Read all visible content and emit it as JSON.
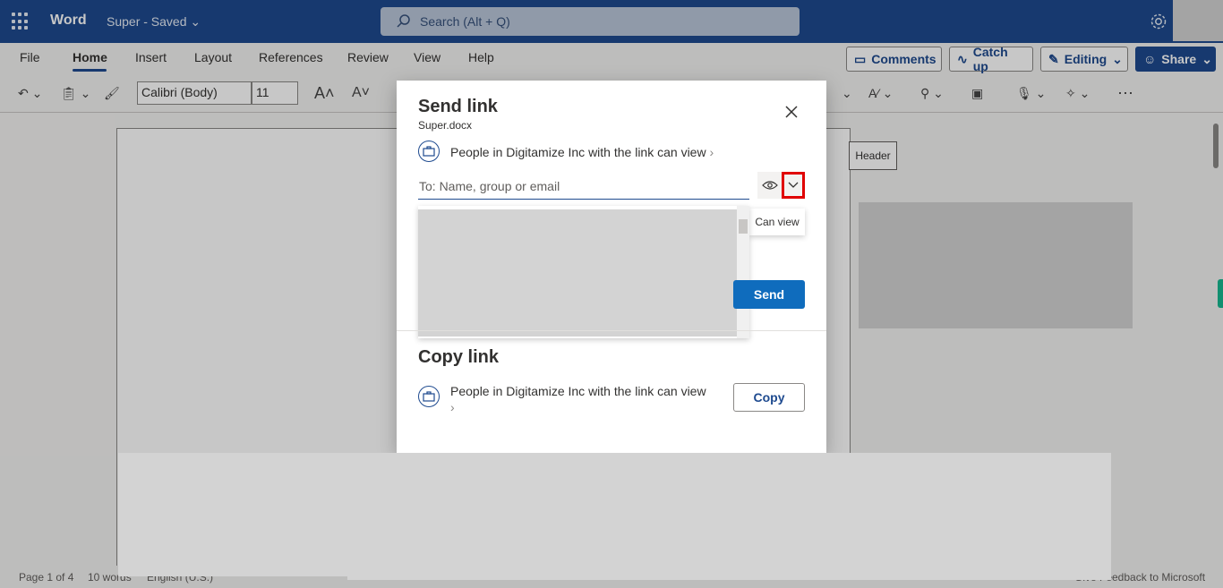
{
  "titlebar": {
    "app_name": "Word",
    "doc_title": "Super - Saved",
    "search_placeholder": "Search (Alt + Q)"
  },
  "ribbon": {
    "tabs": [
      "File",
      "Home",
      "Insert",
      "Layout",
      "References",
      "Review",
      "View",
      "Help"
    ],
    "selected_tab": "Home",
    "comments_label": "Comments",
    "catchup_label": "Catch up",
    "editing_label": "Editing",
    "share_label": "Share",
    "font_name": "Calibri (Body)",
    "font_size": "11"
  },
  "document": {
    "header_tag": "Header"
  },
  "dialog": {
    "title": "Send link",
    "filename": "Super.docx",
    "permission_text": "People in Digitamize Inc with the link can view",
    "to_placeholder": "To: Name, group or email",
    "tooltip": "Can view",
    "send_label": "Send",
    "copy_title": "Copy link",
    "copy_permission_text": "People in Digitamize Inc with the link can view",
    "copy_label": "Copy"
  },
  "statusbar": {
    "page": "Page 1 of 4",
    "words": "10 words",
    "language": "English (U.S.)",
    "feedback": "Give Feedback to Microsoft"
  },
  "colors": {
    "brand": "#1e4a8f",
    "send_button": "#0f6cbd",
    "highlight": "#e00000"
  }
}
